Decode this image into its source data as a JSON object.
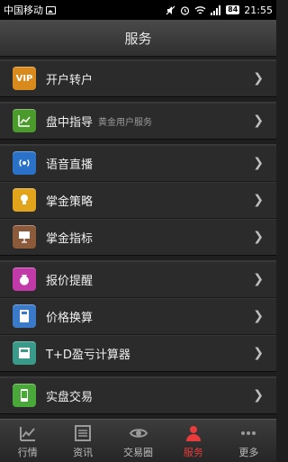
{
  "status_bar": {
    "carrier": "中国移动",
    "battery": "84",
    "time": "21:55"
  },
  "header": {
    "title": "服务"
  },
  "groups": [
    {
      "items": [
        {
          "label": "开户转户",
          "icon": "vip-icon",
          "icon_text": "VIP",
          "icon_color": "#d88a1c"
        }
      ]
    },
    {
      "items": [
        {
          "label": "盘中指导",
          "sub": "黄金用户服务",
          "icon": "chart-icon",
          "icon_color": "#4a9a2c"
        }
      ]
    },
    {
      "items": [
        {
          "label": "语音直播",
          "icon": "broadcast-icon",
          "icon_color": "#2a72c8"
        },
        {
          "label": "掌金策略",
          "icon": "lightbulb-icon",
          "icon_color": "#e2a41b"
        },
        {
          "label": "掌金指标",
          "icon": "presentation-icon",
          "icon_color": "#8a5a3a"
        }
      ]
    },
    {
      "items": [
        {
          "label": "报价提醒",
          "icon": "money-bag-icon",
          "icon_color": "#c23aa8"
        },
        {
          "label": "价格换算",
          "icon": "calculator-icon",
          "icon_color": "#3a7ac8"
        },
        {
          "label": "T+D盈亏计算器",
          "icon": "calculator-board-icon",
          "icon_color": "#3a9a8a"
        }
      ]
    },
    {
      "items": [
        {
          "label": "实盘交易",
          "icon": "phone-trade-icon",
          "icon_color": "#4aa83a"
        }
      ]
    }
  ],
  "tabs": [
    {
      "label": "行情",
      "icon": "market-chart-icon",
      "active": false
    },
    {
      "label": "资讯",
      "icon": "newspaper-icon",
      "active": false
    },
    {
      "label": "交易圈",
      "icon": "eye-icon",
      "active": false
    },
    {
      "label": "服务",
      "icon": "service-person-icon",
      "active": true
    },
    {
      "label": "更多",
      "icon": "more-dots-icon",
      "active": false
    }
  ],
  "colors": {
    "active_tab": "#e83b3b",
    "background": "#1e1e1e"
  }
}
